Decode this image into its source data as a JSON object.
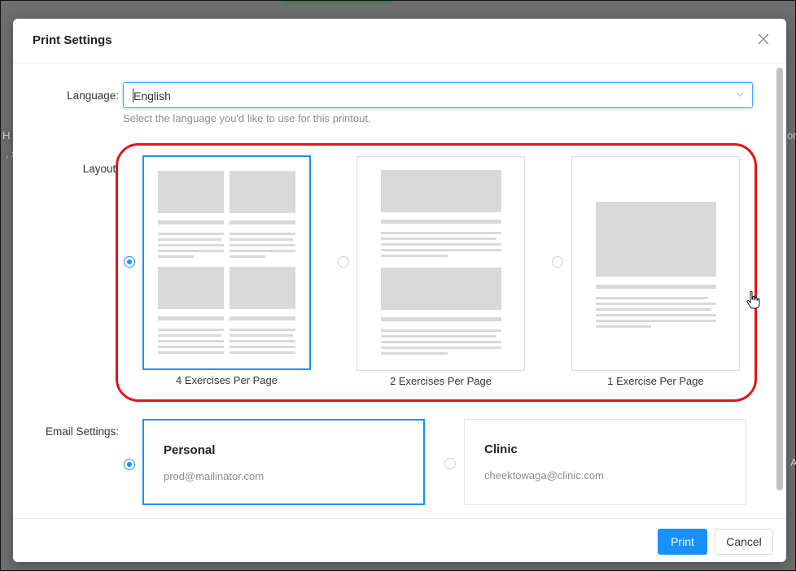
{
  "dialog": {
    "title": "Print Settings",
    "close_glyph": "✕"
  },
  "language": {
    "label": "Language:",
    "value": "English",
    "hint": "Select the language you'd like to use for this printout."
  },
  "layout": {
    "label": "Layout:",
    "options": [
      {
        "label": "4 Exercises Per Page",
        "selected": true
      },
      {
        "label": "2 Exercises Per Page",
        "selected": false
      },
      {
        "label": "1 Exercise Per Page",
        "selected": false
      }
    ]
  },
  "email": {
    "label": "Email Settings:",
    "options": [
      {
        "name": "Personal",
        "address": "prod@mailinator.com",
        "selected": true
      },
      {
        "name": "Clinic",
        "address": "cheektowaga@clinic.com",
        "selected": false
      }
    ]
  },
  "footer": {
    "print_label": "Print",
    "cancel_label": "Cancel"
  },
  "background": {
    "left_fragment_1": "H P",
    "left_fragment_2": ", s",
    "right_fragment_1": "orr",
    "right_fragment_2": "A"
  },
  "colors": {
    "accent": "#1890ff",
    "annotation": "#e0141a",
    "placeholder_block": "#d9d9d9"
  },
  "icons": {
    "close": "close-icon",
    "dropdown": "chevron-down-icon",
    "cursor": "hand-cursor-icon"
  }
}
